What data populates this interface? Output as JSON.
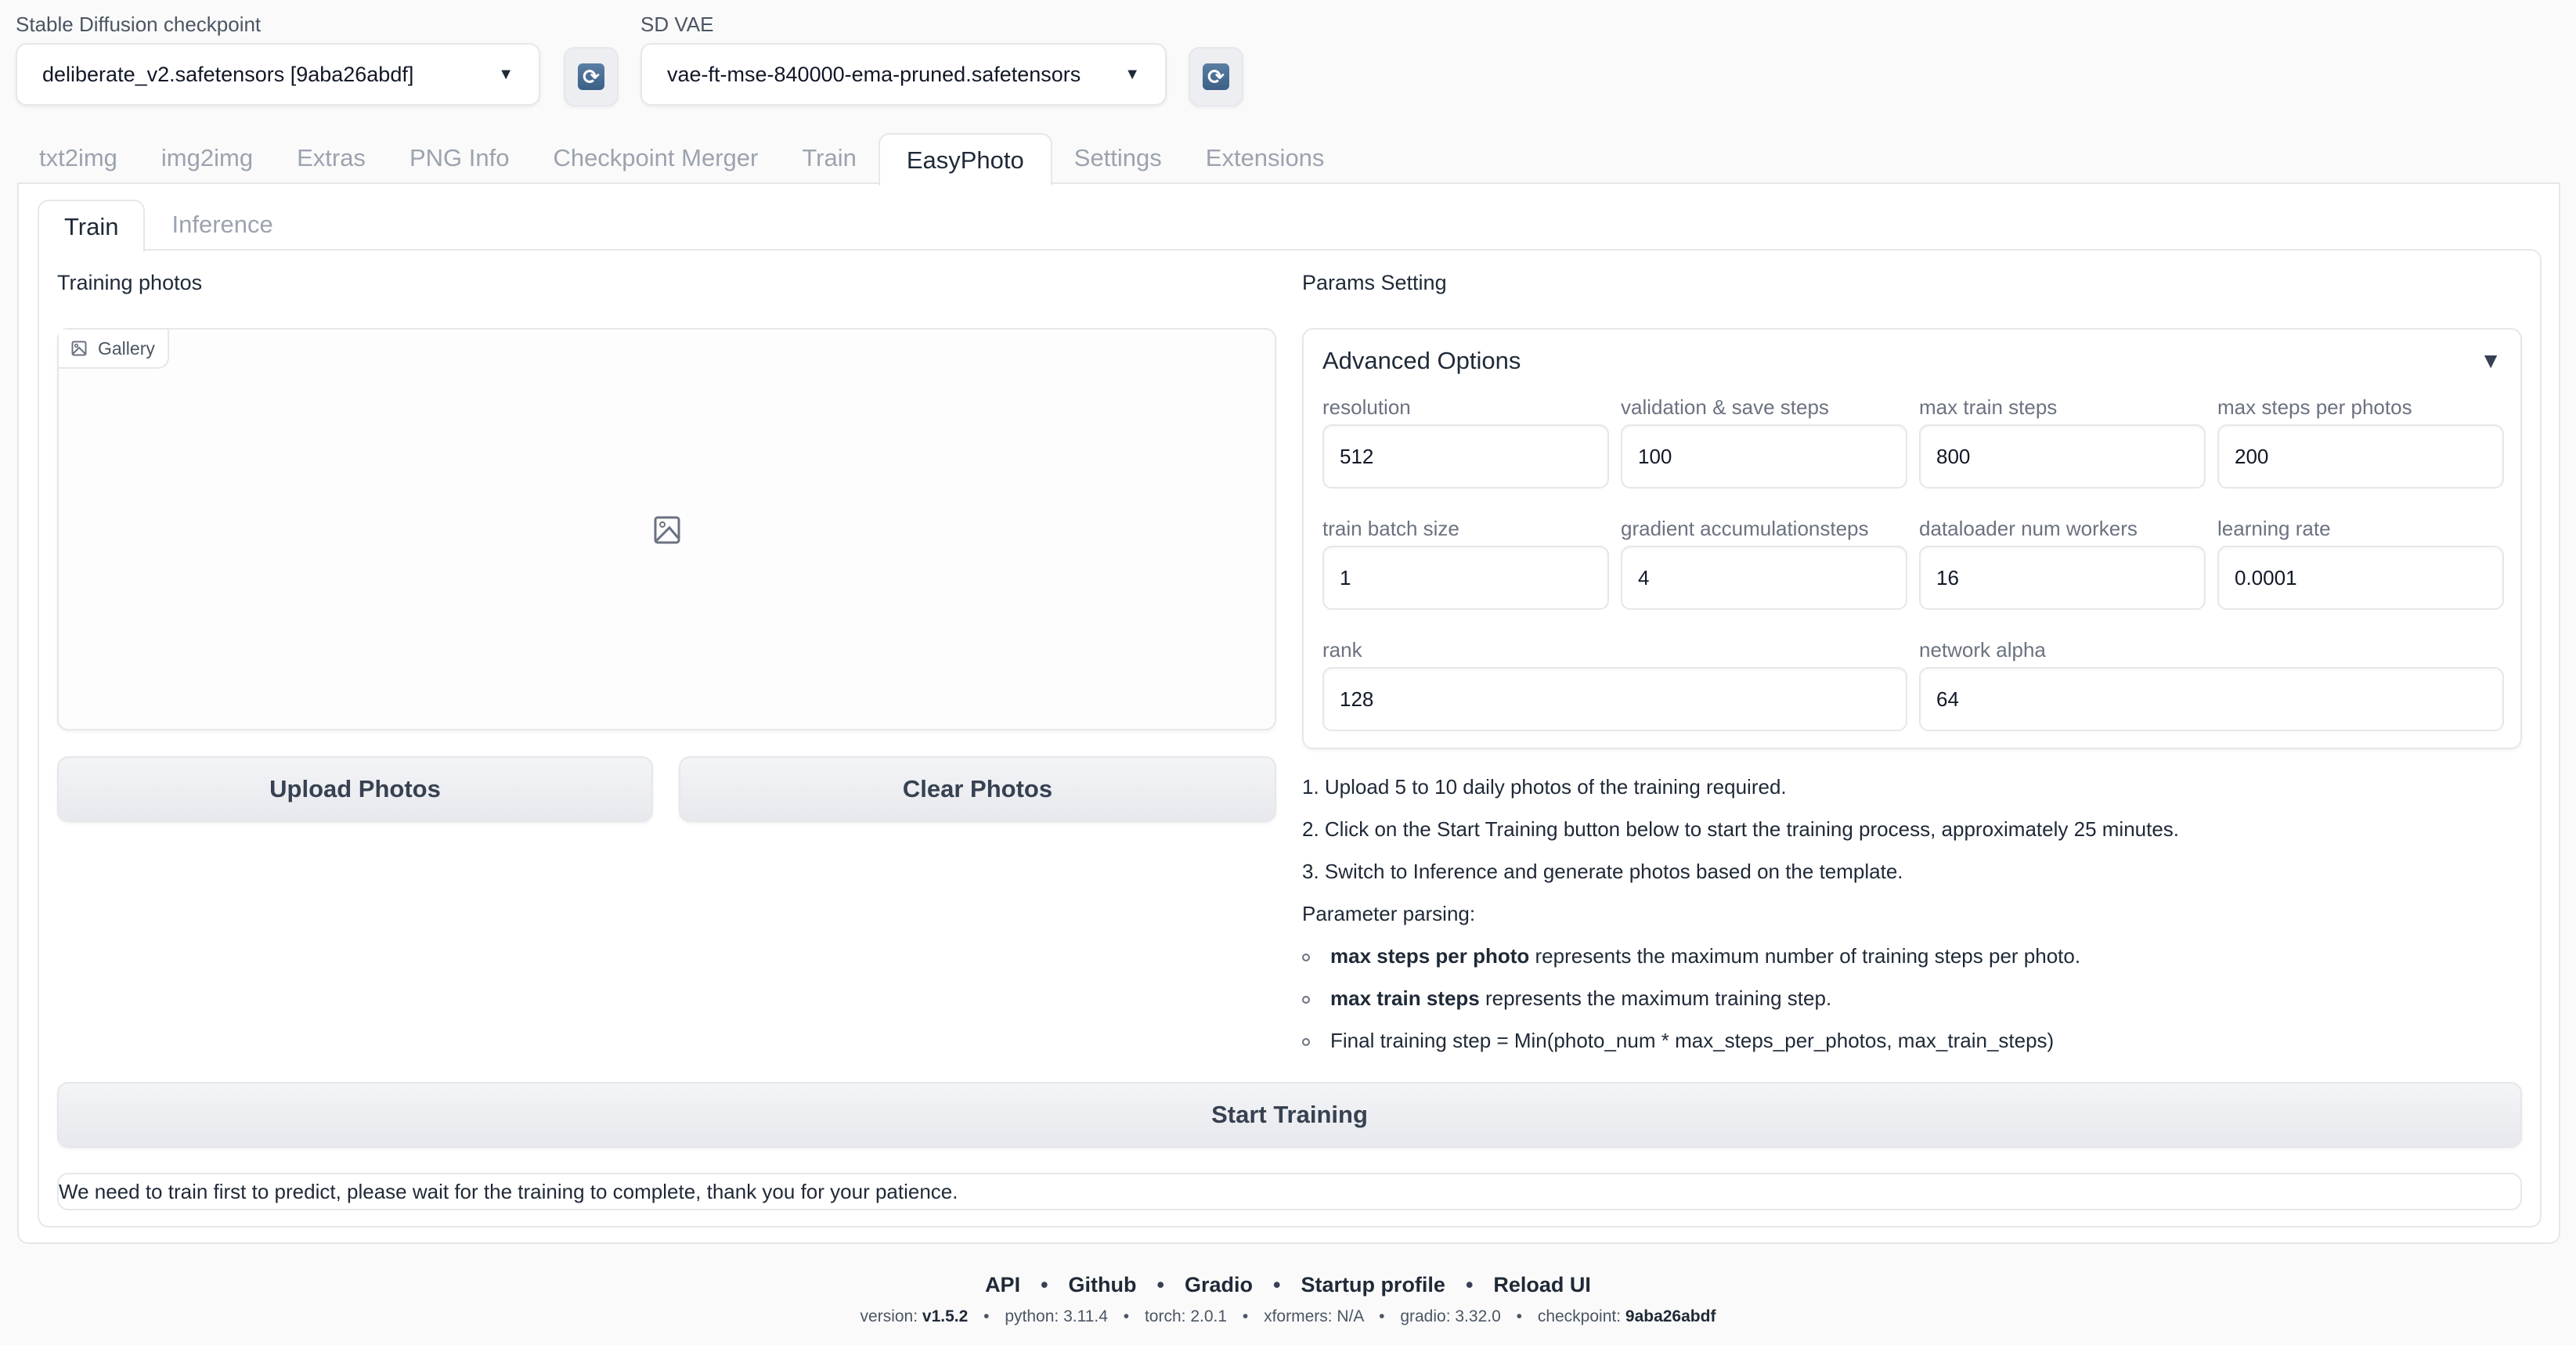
{
  "header": {
    "checkpoint_label": "Stable Diffusion checkpoint",
    "checkpoint_value": "deliberate_v2.safetensors [9aba26abdf]",
    "vae_label": "SD VAE",
    "vae_value": "vae-ft-mse-840000-ema-pruned.safetensors",
    "refresh_glyph": "⟳",
    "caret_glyph": "▼"
  },
  "main_tabs": [
    {
      "label": "txt2img",
      "active": false
    },
    {
      "label": "img2img",
      "active": false
    },
    {
      "label": "Extras",
      "active": false
    },
    {
      "label": "PNG Info",
      "active": false
    },
    {
      "label": "Checkpoint Merger",
      "active": false
    },
    {
      "label": "Train",
      "active": false
    },
    {
      "label": "EasyPhoto",
      "active": true
    },
    {
      "label": "Settings",
      "active": false
    },
    {
      "label": "Extensions",
      "active": false
    }
  ],
  "sub_tabs": [
    {
      "label": "Train",
      "active": true
    },
    {
      "label": "Inference",
      "active": false
    }
  ],
  "training_photos": {
    "label": "Training photos",
    "gallery_tag": "Gallery",
    "upload_button": "Upload Photos",
    "clear_button": "Clear Photos"
  },
  "params": {
    "label": "Params Setting",
    "advanced_title": "Advanced Options",
    "toggle_glyph": "▼",
    "fields": [
      {
        "label": "resolution",
        "value": "512"
      },
      {
        "label": "validation & save steps",
        "value": "100"
      },
      {
        "label": "max train steps",
        "value": "800"
      },
      {
        "label": "max steps per photos",
        "value": "200"
      },
      {
        "label": "train batch size",
        "value": "1"
      },
      {
        "label": "gradient accumulationsteps",
        "value": "4"
      },
      {
        "label": "dataloader num workers",
        "value": "16"
      },
      {
        "label": "learning rate",
        "value": "0.0001"
      },
      {
        "label": "rank",
        "value": "128"
      },
      {
        "label": "network alpha",
        "value": "64"
      }
    ]
  },
  "instructions": {
    "steps": [
      "1. Upload 5 to 10 daily photos of the training required.",
      "2. Click on the Start Training button below to start the training process, approximately 25 minutes.",
      "3. Switch to Inference and generate photos based on the template."
    ],
    "parsing_title": "Parameter parsing:",
    "bullets": [
      {
        "bold": "max steps per photo",
        "text": " represents the maximum number of training steps per photo."
      },
      {
        "bold": "max train steps",
        "text": " represents the maximum training step."
      },
      {
        "bold": "",
        "text": "Final training step = Min(photo_num * max_steps_per_photos, max_train_steps)"
      }
    ]
  },
  "start_button": "Start Training",
  "status_message": "We need to train first to predict, please wait for the training to complete, thank you for your patience.",
  "footer": {
    "links": [
      "API",
      "Github",
      "Gradio",
      "Startup profile",
      "Reload UI"
    ],
    "separator": "•",
    "versions": [
      {
        "key": "version: ",
        "value": "v1.5.2",
        "bold": true
      },
      {
        "key": "python: ",
        "value": "3.11.4",
        "bold": false
      },
      {
        "key": "torch: ",
        "value": "2.0.1",
        "bold": false
      },
      {
        "key": "xformers: ",
        "value": "N/A",
        "bold": false
      },
      {
        "key": "gradio: ",
        "value": "3.32.0",
        "bold": false
      },
      {
        "key": "checkpoint: ",
        "value": "9aba26abdf",
        "bold": true
      }
    ]
  }
}
